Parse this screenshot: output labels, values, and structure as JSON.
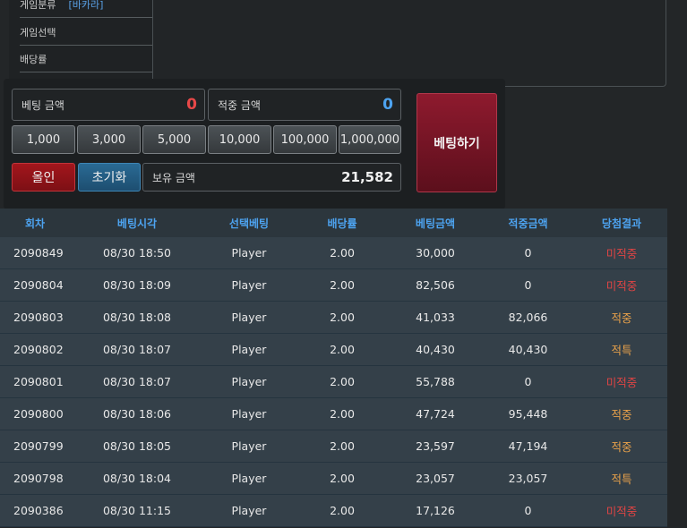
{
  "info": {
    "game_category_label": "게임분류",
    "game_category_value": "[바카라]",
    "game_select_label": "게임선택",
    "odds_label": "배당률"
  },
  "bet": {
    "bet_amount_label": "베팅 금액",
    "bet_amount_value": "0",
    "win_amount_label": "적중 금액",
    "win_amount_value": "0",
    "chips": [
      "1,000",
      "3,000",
      "5,000",
      "10,000",
      "100,000",
      "1,000,000"
    ],
    "allin_label": "올인",
    "reset_label": "초기화",
    "balance_label": "보유 금액",
    "balance_value": "21,582",
    "place_bet_label": "베팅하기"
  },
  "colors": {
    "bet_amount": "#e84848",
    "win_amount": "#4da3f0",
    "miss": "#e04444",
    "hit": "#e8a14a"
  },
  "table": {
    "headers": [
      "회차",
      "베팅시각",
      "선택베팅",
      "배당률",
      "베팅금액",
      "적중금액",
      "당첨결과"
    ],
    "rows": [
      {
        "round": "2090849",
        "time": "08/30 18:50",
        "pick": "Player",
        "odds": "2.00",
        "bet": "30,000",
        "win": "0",
        "result": "미적중",
        "status": "miss"
      },
      {
        "round": "2090804",
        "time": "08/30 18:09",
        "pick": "Player",
        "odds": "2.00",
        "bet": "82,506",
        "win": "0",
        "result": "미적중",
        "status": "miss"
      },
      {
        "round": "2090803",
        "time": "08/30 18:08",
        "pick": "Player",
        "odds": "2.00",
        "bet": "41,033",
        "win": "82,066",
        "result": "적중",
        "status": "hit"
      },
      {
        "round": "2090802",
        "time": "08/30 18:07",
        "pick": "Player",
        "odds": "2.00",
        "bet": "40,430",
        "win": "40,430",
        "result": "적특",
        "status": "hit"
      },
      {
        "round": "2090801",
        "time": "08/30 18:07",
        "pick": "Player",
        "odds": "2.00",
        "bet": "55,788",
        "win": "0",
        "result": "미적중",
        "status": "miss"
      },
      {
        "round": "2090800",
        "time": "08/30 18:06",
        "pick": "Player",
        "odds": "2.00",
        "bet": "47,724",
        "win": "95,448",
        "result": "적중",
        "status": "hit"
      },
      {
        "round": "2090799",
        "time": "08/30 18:05",
        "pick": "Player",
        "odds": "2.00",
        "bet": "23,597",
        "win": "47,194",
        "result": "적중",
        "status": "hit"
      },
      {
        "round": "2090798",
        "time": "08/30 18:04",
        "pick": "Player",
        "odds": "2.00",
        "bet": "23,057",
        "win": "23,057",
        "result": "적특",
        "status": "hit"
      },
      {
        "round": "2090386",
        "time": "08/30 11:15",
        "pick": "Player",
        "odds": "2.00",
        "bet": "17,126",
        "win": "0",
        "result": "미적중",
        "status": "miss"
      }
    ]
  }
}
